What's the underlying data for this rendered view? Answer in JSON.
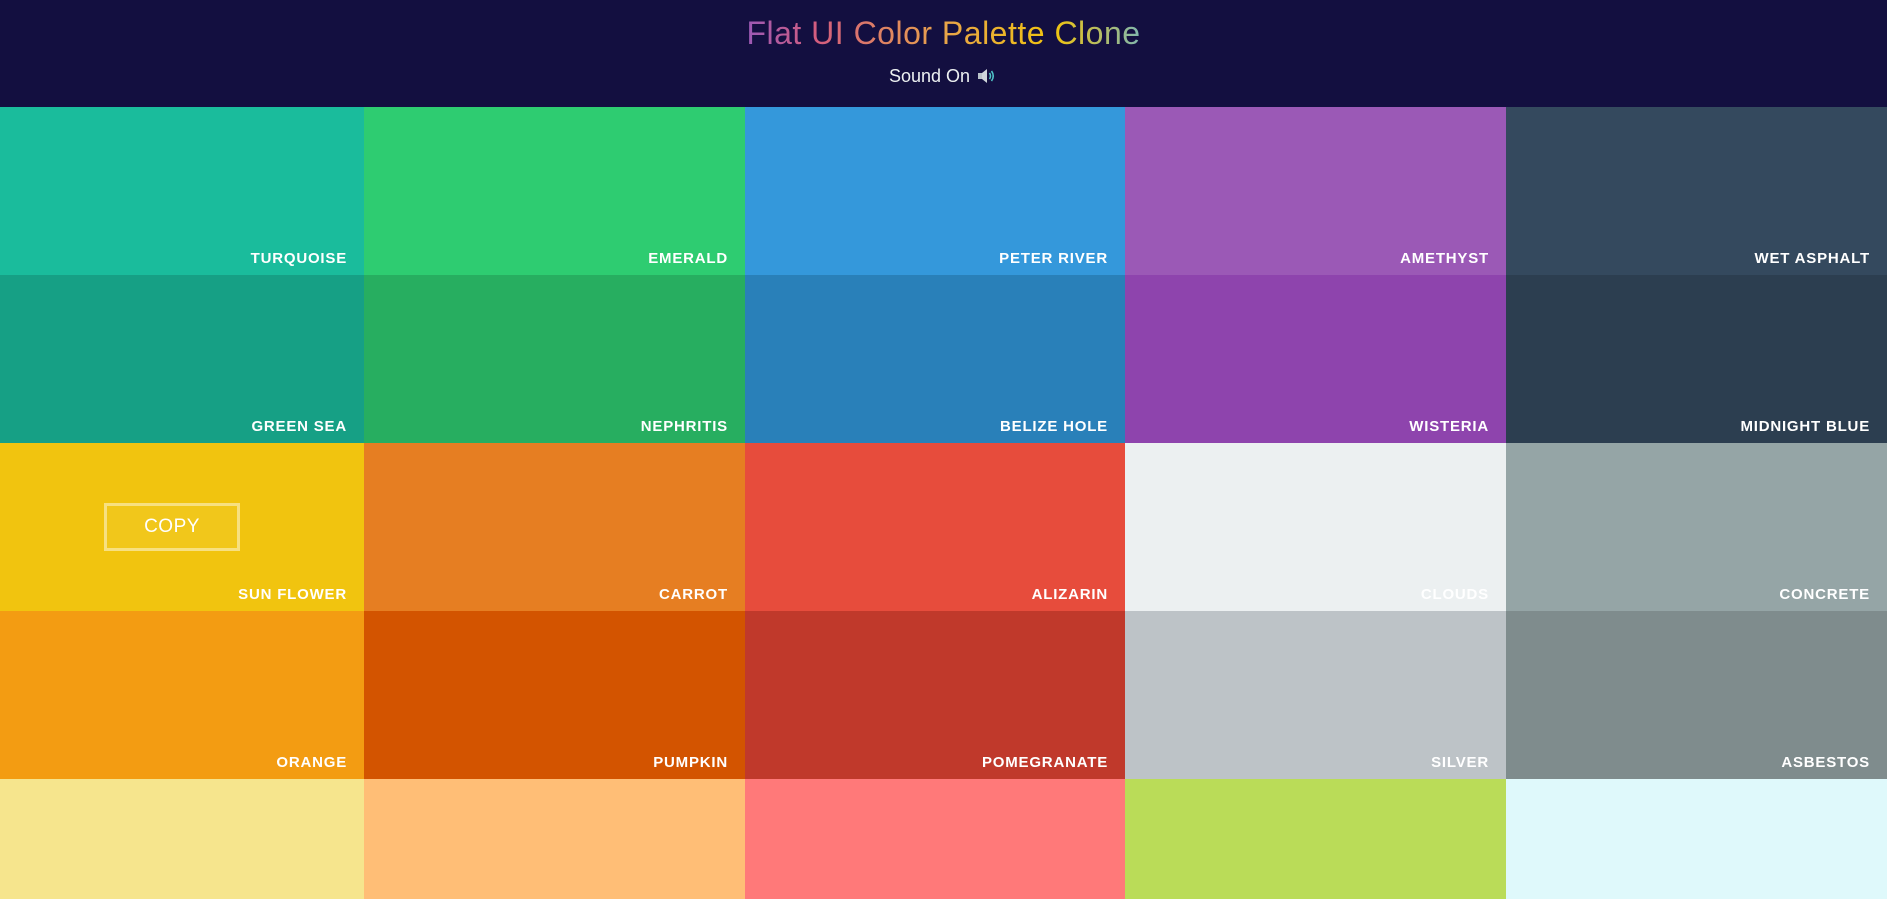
{
  "header": {
    "title": "Flat UI Color Palette Clone",
    "sound_label": "Sound On",
    "sound_icon": "speaker-icon"
  },
  "palette": {
    "copy_label": "COPY",
    "colors": [
      {
        "name": "TURQUOISE",
        "hex": "#1abc9c"
      },
      {
        "name": "EMERALD",
        "hex": "#2ecc71"
      },
      {
        "name": "PETER RIVER",
        "hex": "#3498db"
      },
      {
        "name": "AMETHYST",
        "hex": "#9b59b6"
      },
      {
        "name": "WET ASPHALT",
        "hex": "#34495e"
      },
      {
        "name": "GREEN SEA",
        "hex": "#16a085"
      },
      {
        "name": "NEPHRITIS",
        "hex": "#27ae60"
      },
      {
        "name": "BELIZE HOLE",
        "hex": "#2980b9"
      },
      {
        "name": "WISTERIA",
        "hex": "#8e44ad"
      },
      {
        "name": "MIDNIGHT BLUE",
        "hex": "#2c3e50"
      },
      {
        "name": "SUN FLOWER",
        "hex": "#f1c40f"
      },
      {
        "name": "CARROT",
        "hex": "#e67e22"
      },
      {
        "name": "ALIZARIN",
        "hex": "#e74c3c"
      },
      {
        "name": "CLOUDS",
        "hex": "#ecf0f1"
      },
      {
        "name": "CONCRETE",
        "hex": "#95a5a6"
      },
      {
        "name": "ORANGE",
        "hex": "#f39c12"
      },
      {
        "name": "PUMPKIN",
        "hex": "#d35400"
      },
      {
        "name": "POMEGRANATE",
        "hex": "#c0392b"
      },
      {
        "name": "SILVER",
        "hex": "#bdc3c7"
      },
      {
        "name": "ASBESTOS",
        "hex": "#7f8c8d"
      },
      {
        "name": "",
        "hex": "#f6e58d"
      },
      {
        "name": "",
        "hex": "#ffbe76"
      },
      {
        "name": "",
        "hex": "#ff7979"
      },
      {
        "name": "",
        "hex": "#badc58"
      },
      {
        "name": "",
        "hex": "#dff9fb"
      }
    ]
  }
}
